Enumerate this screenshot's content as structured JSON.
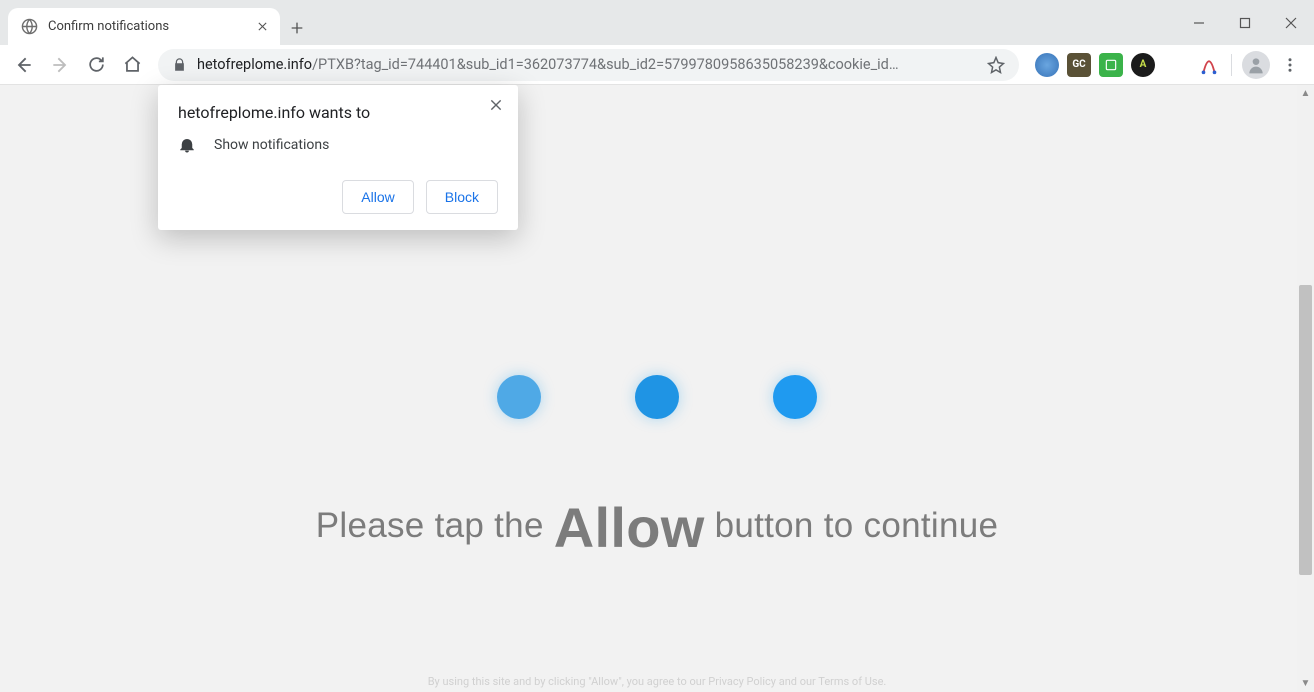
{
  "tab": {
    "title": "Confirm notifications"
  },
  "url": {
    "domain": "hetofreplome.info",
    "path": "/PTXB?tag_id=744401&sub_id1=362073774&sub_id2=5799780958635058239&cookie_id…"
  },
  "extensions": {
    "e2_label": "GC",
    "e4_label": "A"
  },
  "permission": {
    "title": "hetofreplome.info wants to",
    "item": "Show notifications",
    "allow": "Allow",
    "block": "Block"
  },
  "page": {
    "line_pre": "Please tap the ",
    "allow_word": "Allow",
    "line_post": " button to continue",
    "footer": "By using this site and by clicking \"Allow\", you agree to our Privacy Policy and our Terms of Use."
  }
}
